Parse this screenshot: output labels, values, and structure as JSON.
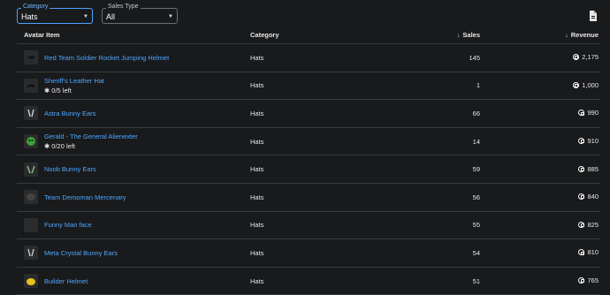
{
  "filters": {
    "category": {
      "legend": "Category",
      "value": "Hats"
    },
    "sales_type": {
      "legend": "Sales Type",
      "value": "All"
    }
  },
  "icons": {
    "export": "export-file-icon",
    "currency": "robux-icon",
    "limited": "limited-icon"
  },
  "columns": {
    "item": "Avatar Item",
    "category": "Category",
    "sales": "Sales",
    "revenue": "Revenue",
    "sort_arrow": "↓"
  },
  "colors": {
    "link": "#4da7ff",
    "background": "#191a1c",
    "focus": "#4aa3ff"
  },
  "rows": [
    {
      "name": "Red Team Soldier Rocket Jumping Helmet",
      "stock": "",
      "category": "Hats",
      "sales": "145",
      "revenue": "2,175"
    },
    {
      "name": "Sheriff's Leather Hat",
      "stock": "0/5 left",
      "category": "Hats",
      "sales": "1",
      "revenue": "1,000"
    },
    {
      "name": "Astra Bunny Ears",
      "stock": "",
      "category": "Hats",
      "sales": "66",
      "revenue": "990"
    },
    {
      "name": "Gerald - The General Alienexter",
      "stock": "0/20 left",
      "category": "Hats",
      "sales": "14",
      "revenue": "910"
    },
    {
      "name": "Noob Bunny Ears",
      "stock": "",
      "category": "Hats",
      "sales": "59",
      "revenue": "885"
    },
    {
      "name": "Team Demoman Mercenary",
      "stock": "",
      "category": "Hats",
      "sales": "56",
      "revenue": "840"
    },
    {
      "name": "Funny Man face",
      "stock": "",
      "category": "Hats",
      "sales": "55",
      "revenue": "825"
    },
    {
      "name": "Meta Crystal Bunny Ears",
      "stock": "",
      "category": "Hats",
      "sales": "54",
      "revenue": "810"
    },
    {
      "name": "Builder Helmet",
      "stock": "",
      "category": "Hats",
      "sales": "51",
      "revenue": "765"
    }
  ]
}
